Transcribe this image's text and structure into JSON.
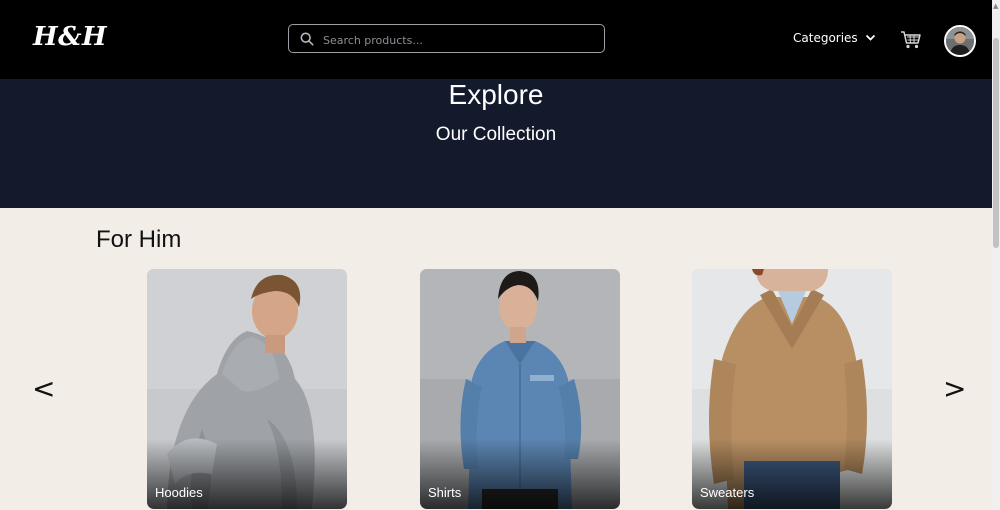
{
  "header": {
    "logo": "H&H",
    "search_placeholder": "Search products...",
    "categories_label": "Categories",
    "cart_icon": "cart-icon",
    "avatar_icon": "user-avatar"
  },
  "hero": {
    "title": "Explore",
    "subtitle": "Our Collection"
  },
  "section": {
    "title": "For Him",
    "prev_label": "<",
    "next_label": ">",
    "cards": [
      {
        "label": "Hoodies"
      },
      {
        "label": "Shirts"
      },
      {
        "label": "Sweaters"
      }
    ]
  },
  "colors": {
    "header_bg": "#000000",
    "hero_bg": "#131a2c",
    "page_bg": "#f3ede8"
  }
}
